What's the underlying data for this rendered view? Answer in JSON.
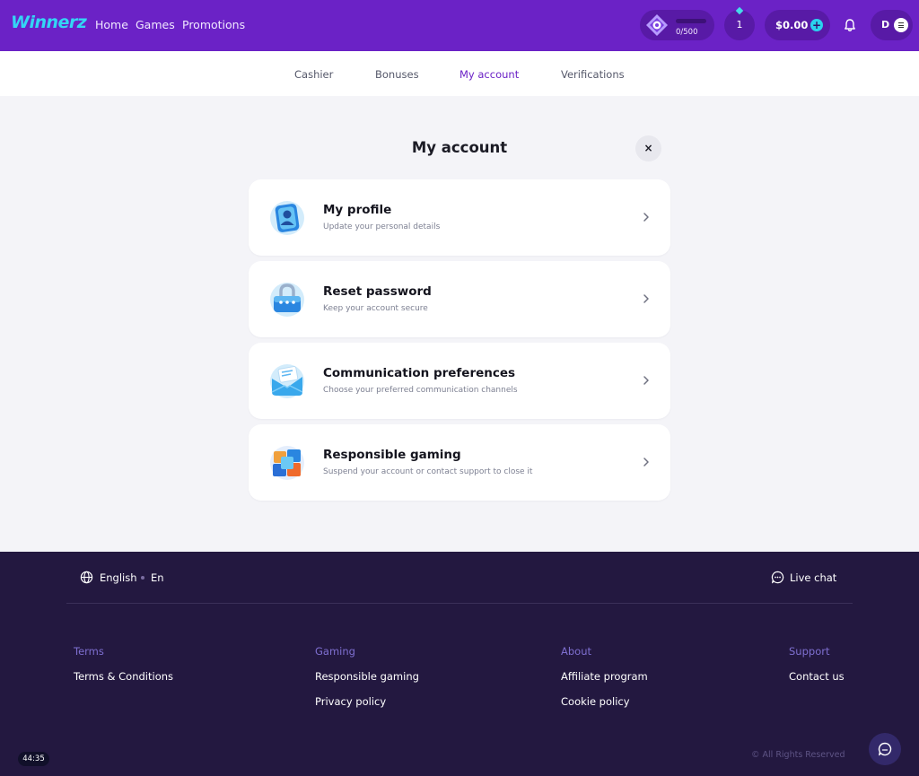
{
  "header": {
    "logo": "Winnerz",
    "nav": [
      "Home",
      "Games",
      "Promotions"
    ],
    "xp_progress": "0/500",
    "xp_fraction": 0,
    "level": "1",
    "balance": "$0.00",
    "user_initial": "D"
  },
  "tabs": [
    {
      "label": "Cashier",
      "active": false
    },
    {
      "label": "Bonuses",
      "active": false
    },
    {
      "label": "My account",
      "active": true
    },
    {
      "label": "Verifications",
      "active": false
    }
  ],
  "main": {
    "title": "My account",
    "close_label": "×",
    "cards": [
      {
        "title": "My profile",
        "subtitle": "Update your personal details",
        "icon": "profile-icon"
      },
      {
        "title": "Reset password",
        "subtitle": "Keep your account secure",
        "icon": "lock-icon"
      },
      {
        "title": "Communication preferences",
        "subtitle": "Choose your preferred communication channels",
        "icon": "envelope-icon"
      },
      {
        "title": "Responsible gaming",
        "subtitle": "Suspend your account or contact support to close it",
        "icon": "cube-icon"
      }
    ]
  },
  "footer": {
    "language": "English",
    "language_code": "En",
    "live_chat": "Live chat",
    "columns": [
      {
        "heading": "Terms",
        "links": [
          "Terms & Conditions"
        ]
      },
      {
        "heading": "Gaming",
        "links": [
          "Responsible gaming",
          "Privacy policy"
        ]
      },
      {
        "heading": "About",
        "links": [
          "Affiliate program",
          "Cookie policy"
        ]
      },
      {
        "heading": "Support",
        "links": [
          "Contact us"
        ]
      }
    ],
    "rights": "© All Rights Reserved"
  },
  "timer": "44:35",
  "colors": {
    "brand": "#6b22c6",
    "accent": "#2ad3ee",
    "footer": "#231840"
  }
}
